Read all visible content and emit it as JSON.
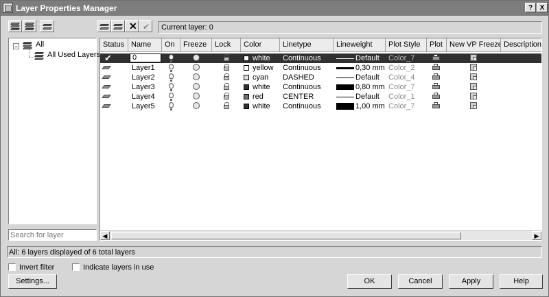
{
  "window": {
    "title": "Layer Properties Manager",
    "help_glyph": "?",
    "close_glyph": "X"
  },
  "toolbar": {
    "current_layer_text": "Current layer: 0"
  },
  "tree": {
    "items": [
      {
        "label": "All"
      },
      {
        "label": "All Used Layers"
      }
    ]
  },
  "search": {
    "placeholder": "Search for layer"
  },
  "grid": {
    "columns": [
      "Status",
      "Name",
      "On",
      "Freeze",
      "Lock",
      "Color",
      "Linetype",
      "Lineweight",
      "Plot Style",
      "Plot",
      "New VP Freeze",
      "Description"
    ],
    "rows": [
      {
        "status": "current",
        "name": "0",
        "color_name": "white",
        "color_hex": "#ffffff",
        "linetype": "Continuous",
        "lineweight": "Default",
        "plot_style": "Color_7",
        "selected": true
      },
      {
        "status": "layer",
        "name": "Layer1",
        "color_name": "yellow",
        "color_hex": "#ffffff",
        "linetype": "Continuous",
        "lineweight": "0,30 mm",
        "plot_style": "Color_2",
        "selected": false
      },
      {
        "status": "layer",
        "name": "Layer2",
        "color_name": "cyan",
        "color_hex": "#e0e0e0",
        "linetype": "DASHED",
        "lineweight": "Default",
        "plot_style": "Color_4",
        "selected": false
      },
      {
        "status": "layer",
        "name": "Layer3",
        "color_name": "white",
        "color_hex": "#303030",
        "linetype": "Continuous",
        "lineweight": "0,80 mm",
        "plot_style": "Color_7",
        "selected": false
      },
      {
        "status": "layer",
        "name": "Layer4",
        "color_name": "red",
        "color_hex": "#707070",
        "linetype": "CENTER",
        "lineweight": "Default",
        "plot_style": "Color_1",
        "selected": false
      },
      {
        "status": "layer",
        "name": "Layer5",
        "color_name": "white",
        "color_hex": "#303030",
        "linetype": "Continuous",
        "lineweight": "1,00 mm",
        "plot_style": "Color_7",
        "selected": false
      }
    ]
  },
  "status_bar": {
    "text": "All: 6 layers displayed of 6 total layers"
  },
  "options": {
    "invert_filter": "Invert filter",
    "indicate_layers": "Indicate layers in use"
  },
  "buttons": {
    "settings": "Settings...",
    "ok": "OK",
    "cancel": "Cancel",
    "apply": "Apply",
    "help": "Help"
  },
  "colors": {
    "title_bar": "#7d7d7d",
    "dialog_bg": "#d6d6d6",
    "selected_row": "#303030"
  }
}
